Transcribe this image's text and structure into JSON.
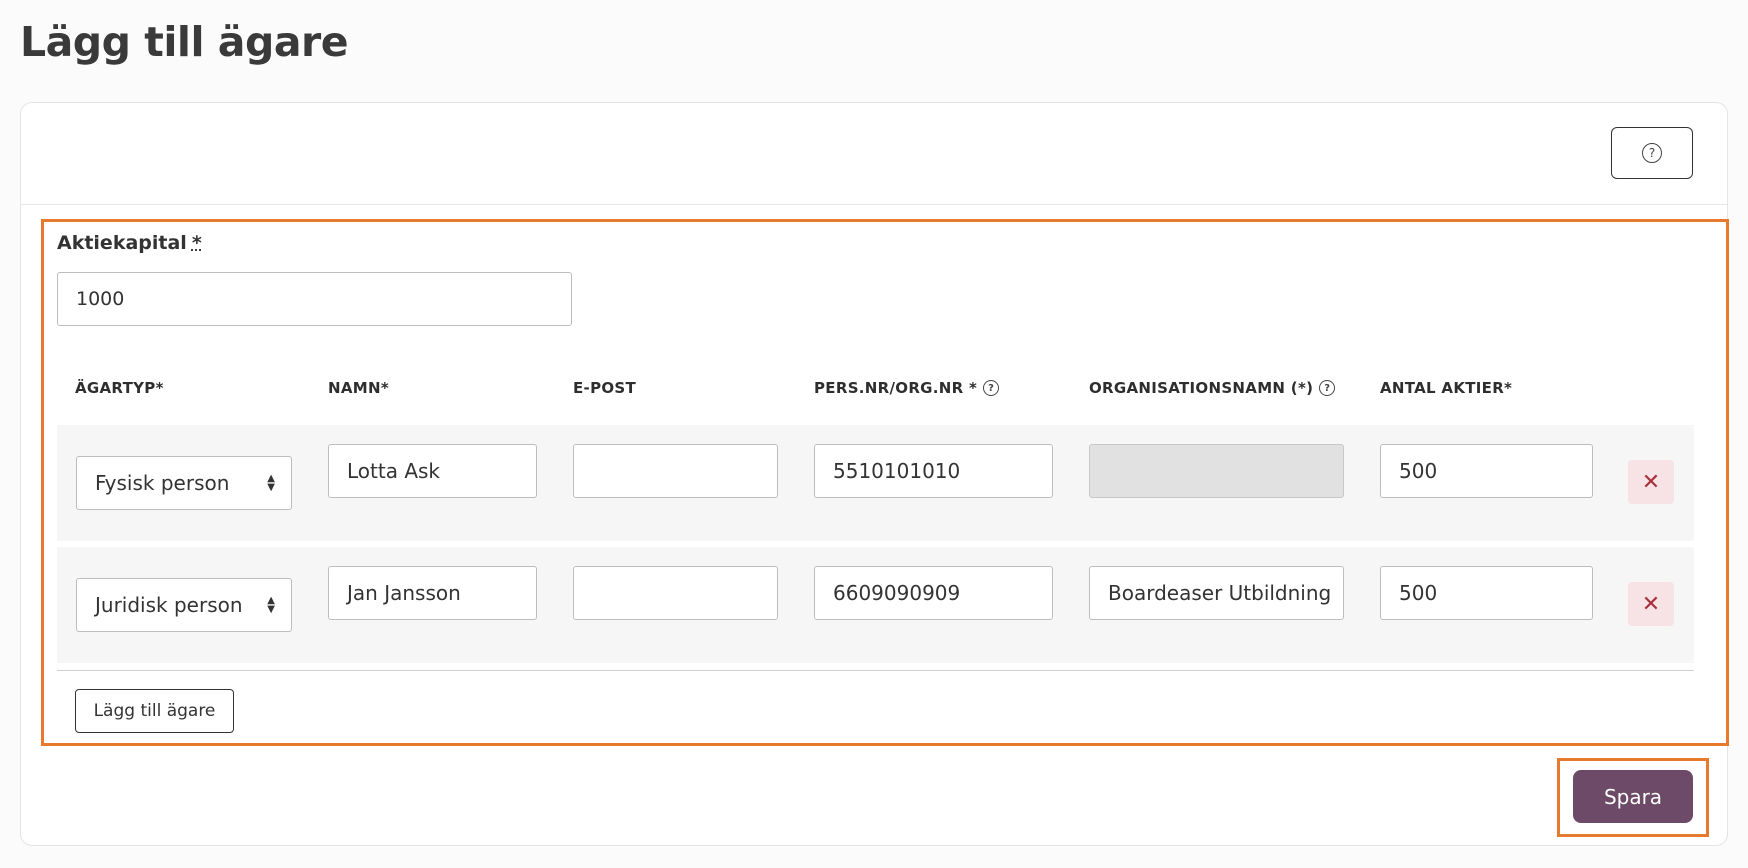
{
  "page": {
    "title": "Lägg till ägare"
  },
  "help_button": {
    "icon": "question-circle-icon",
    "glyph": "?"
  },
  "share_capital": {
    "label": "Aktiekapital",
    "required_marker": "*",
    "value": "1000"
  },
  "table": {
    "headers": [
      {
        "label": "ÄGARTYP*",
        "has_help": false
      },
      {
        "label": "NAMN*",
        "has_help": false
      },
      {
        "label": "E-POST",
        "has_help": false
      },
      {
        "label": "PERS.NR/ORG.NR *",
        "has_help": true
      },
      {
        "label": "ORGANISATIONSNAMN (*)",
        "has_help": true
      },
      {
        "label": "ANTAL AKTIER*",
        "has_help": false
      }
    ],
    "help_glyph": "?",
    "rows": [
      {
        "owner_type": "Fysisk person",
        "name": "Lotta Ask",
        "email": "",
        "id_number": "5510101010",
        "org_name": "",
        "org_name_disabled": true,
        "shares": "500",
        "remove_glyph": "✕"
      },
      {
        "owner_type": "Juridisk person",
        "name": "Jan Jansson",
        "email": "",
        "id_number": "6609090909",
        "org_name": "Boardeaser Utbildning",
        "org_name_disabled": false,
        "shares": "500",
        "remove_glyph": "✕"
      }
    ]
  },
  "add_owner_button": {
    "label": "Lägg till ägare"
  },
  "save_button": {
    "label": "Spara"
  },
  "colors": {
    "accent": "#6c4a68",
    "highlight": "#e87a2e",
    "danger": "#a6313d"
  }
}
